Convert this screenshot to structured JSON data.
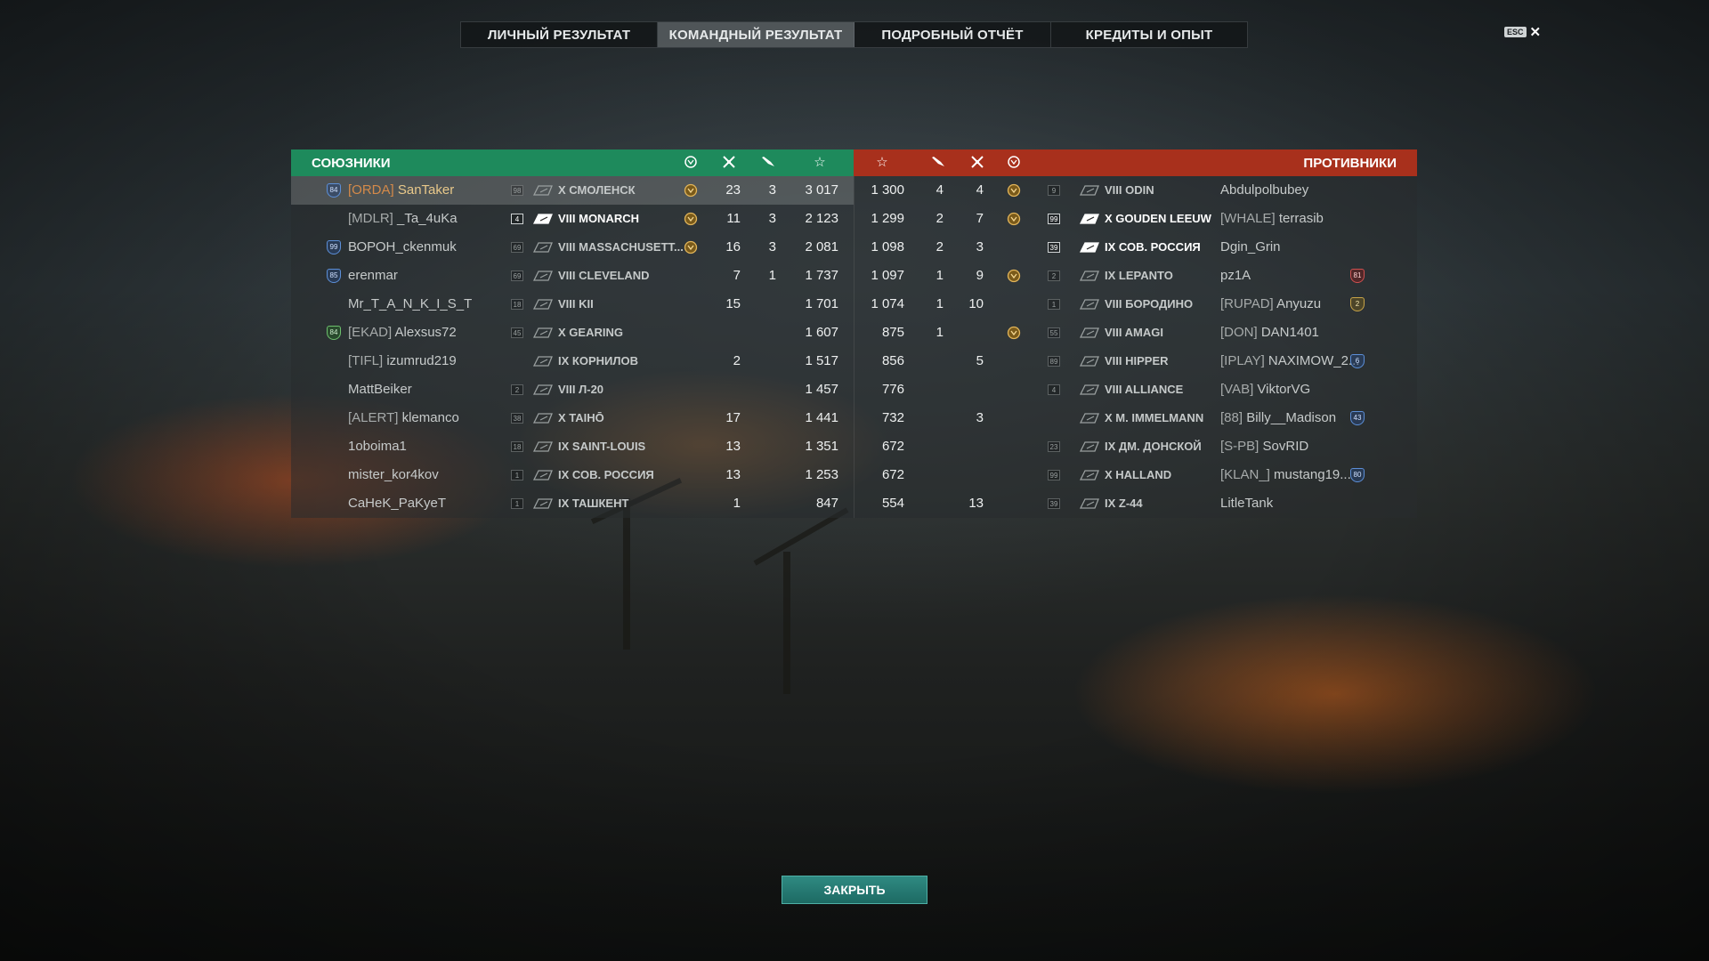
{
  "tabs": [
    "ЛИЧНЫЙ РЕЗУЛЬТАТ",
    "КОМАНДНЫЙ РЕЗУЛЬТАТ",
    "ПОДРОБНЫЙ ОТЧЁТ",
    "КРЕДИТЫ И ОПЫТ"
  ],
  "active_tab": 1,
  "esc_label": "ESC",
  "close_x": "✕",
  "allies_title": "СОЮЗНИКИ",
  "enemies_title": "ПРОТИВНИКИ",
  "close_button": "ЗАКРЫТЬ",
  "colors": {
    "allies": "#1e8a5c",
    "enemies": "#a8301c",
    "close": "#2f8a82"
  },
  "allies": [
    {
      "rank": "84",
      "rank_color": "blue",
      "clan": "[ORDA]",
      "player": "SanTaker",
      "me": true,
      "lvl": "98",
      "ship": "X СМОЛЕНСК",
      "medal": true,
      "c1": "23",
      "c2": "3",
      "score": "3 017"
    },
    {
      "rank": "",
      "clan": "[MDLR]",
      "player": "_Ta_4uKa",
      "lvl": "4",
      "ship": "VIII MONARCH",
      "bold": true,
      "lvl_hi": true,
      "medal": true,
      "c1": "11",
      "c2": "3",
      "score": "2 123"
    },
    {
      "rank": "99",
      "rank_color": "blue",
      "clan": "",
      "player": "ВОРОН_ckenmuk",
      "lvl": "69",
      "ship": "VIII MASSACHUSETT...",
      "medal": true,
      "c1": "16",
      "c2": "3",
      "score": "2 081"
    },
    {
      "rank": "85",
      "rank_color": "blue",
      "clan": "",
      "player": "erenmar",
      "lvl": "69",
      "ship": "VIII CLEVELAND",
      "medal": false,
      "c1": "7",
      "c2": "1",
      "score": "1 737"
    },
    {
      "rank": "",
      "clan": "",
      "player": "Mr_T_A_N_K_I_S_T",
      "lvl": "18",
      "ship": "VIII KII",
      "medal": false,
      "c1": "15",
      "c2": "",
      "score": "1 701"
    },
    {
      "rank": "84",
      "rank_color": "green",
      "clan": "[EKAD]",
      "player": "Alexsus72",
      "lvl": "45",
      "ship": "X GEARING",
      "medal": false,
      "c1": "",
      "c2": "",
      "score": "1 607"
    },
    {
      "rank": "",
      "clan": "[TIFL]",
      "player": "izumrud219",
      "lvl": "",
      "ship": "IX КОРНИЛОВ",
      "medal": false,
      "c1": "2",
      "c2": "",
      "score": "1 517"
    },
    {
      "rank": "",
      "clan": "",
      "player": "MattBeiker",
      "lvl": "2",
      "ship": "VIII Л-20",
      "medal": false,
      "c1": "",
      "c2": "",
      "score": "1 457"
    },
    {
      "rank": "",
      "clan": "[ALERT]",
      "player": "klemanco",
      "lvl": "38",
      "ship": "X TAIHŌ",
      "medal": false,
      "c1": "17",
      "c2": "",
      "score": "1 441"
    },
    {
      "rank": "",
      "clan": "",
      "player": "1oboima1",
      "lvl": "18",
      "ship": "IX SAINT-LOUIS",
      "medal": false,
      "c1": "13",
      "c2": "",
      "score": "1 351"
    },
    {
      "rank": "",
      "clan": "",
      "player": "mister_kor4kov",
      "lvl": "1",
      "ship": "IX СОВ. РОССИЯ",
      "medal": false,
      "c1": "13",
      "c2": "",
      "score": "1 253"
    },
    {
      "rank": "",
      "clan": "",
      "player": "CaHeK_PaKyeT",
      "lvl": "1",
      "ship": "IX ТАШКЕНТ",
      "medal": false,
      "c1": "1",
      "c2": "",
      "score": "847"
    }
  ],
  "enemies": [
    {
      "score": "1 300",
      "c2": "4",
      "c1": "4",
      "medal": true,
      "lvl": "9",
      "ship": "VIII ODIN",
      "clan": "",
      "player": "Abdulpolbubey",
      "rank": ""
    },
    {
      "score": "1 299",
      "c2": "2",
      "c1": "7",
      "medal": true,
      "lvl": "99",
      "lvl_hi": true,
      "ship": "X GOUDEN LEEUW",
      "bold": true,
      "clan": "[WHALE]",
      "player": "terrasib",
      "rank": ""
    },
    {
      "score": "1 098",
      "c2": "2",
      "c1": "3",
      "medal": false,
      "lvl": "39",
      "lvl_hi": true,
      "ship": "IX СОВ. РОССИЯ",
      "bold": true,
      "clan": "",
      "player": "Dgin_Grin",
      "rank": ""
    },
    {
      "score": "1 097",
      "c2": "1",
      "c1": "9",
      "medal": true,
      "lvl": "2",
      "ship": "IX LEPANTO",
      "clan": "",
      "player": "pz1A",
      "rank": "81",
      "rank_color": "red"
    },
    {
      "score": "1 074",
      "c2": "1",
      "c1": "10",
      "medal": false,
      "lvl": "1",
      "ship": "VIII БОРОДИНО",
      "clan": "[RUPAD]",
      "player": "Anyuzu",
      "rank": "2",
      "rank_color": "gold"
    },
    {
      "score": "875",
      "c2": "1",
      "c1": "",
      "medal": true,
      "lvl": "55",
      "ship": "VIII AMAGI",
      "clan": "[DON]",
      "player": "DAN1401",
      "rank": ""
    },
    {
      "score": "856",
      "c2": "",
      "c1": "5",
      "medal": false,
      "lvl": "89",
      "ship": "VIII HIPPER",
      "clan": "[IPLAY]",
      "player": "NAXIMOW_2...",
      "rank": "6",
      "rank_color": "blue"
    },
    {
      "score": "776",
      "c2": "",
      "c1": "",
      "medal": false,
      "lvl": "4",
      "ship": "VIII ALLIANCE",
      "clan": "[VAB]",
      "player": "ViktorVG",
      "rank": ""
    },
    {
      "score": "732",
      "c2": "",
      "c1": "3",
      "medal": false,
      "lvl": "",
      "ship": "X M. IMMELMANN",
      "clan": "[88]",
      "player": "Billy__Madison",
      "rank": "43",
      "rank_color": "blue"
    },
    {
      "score": "672",
      "c2": "",
      "c1": "",
      "medal": false,
      "lvl": "23",
      "ship": "IX ДМ. ДОНСКОЙ",
      "clan": "[S-PB]",
      "player": "SovRID",
      "rank": ""
    },
    {
      "score": "672",
      "c2": "",
      "c1": "",
      "medal": false,
      "lvl": "99",
      "ship": "X HALLAND",
      "clan": "[KLAN_]",
      "player": "mustang19...",
      "rank": "80",
      "rank_color": "blue"
    },
    {
      "score": "554",
      "c2": "",
      "c1": "13",
      "medal": false,
      "lvl": "39",
      "ship": "IX Z-44",
      "clan": "",
      "player": "LitleTank",
      "rank": ""
    }
  ]
}
